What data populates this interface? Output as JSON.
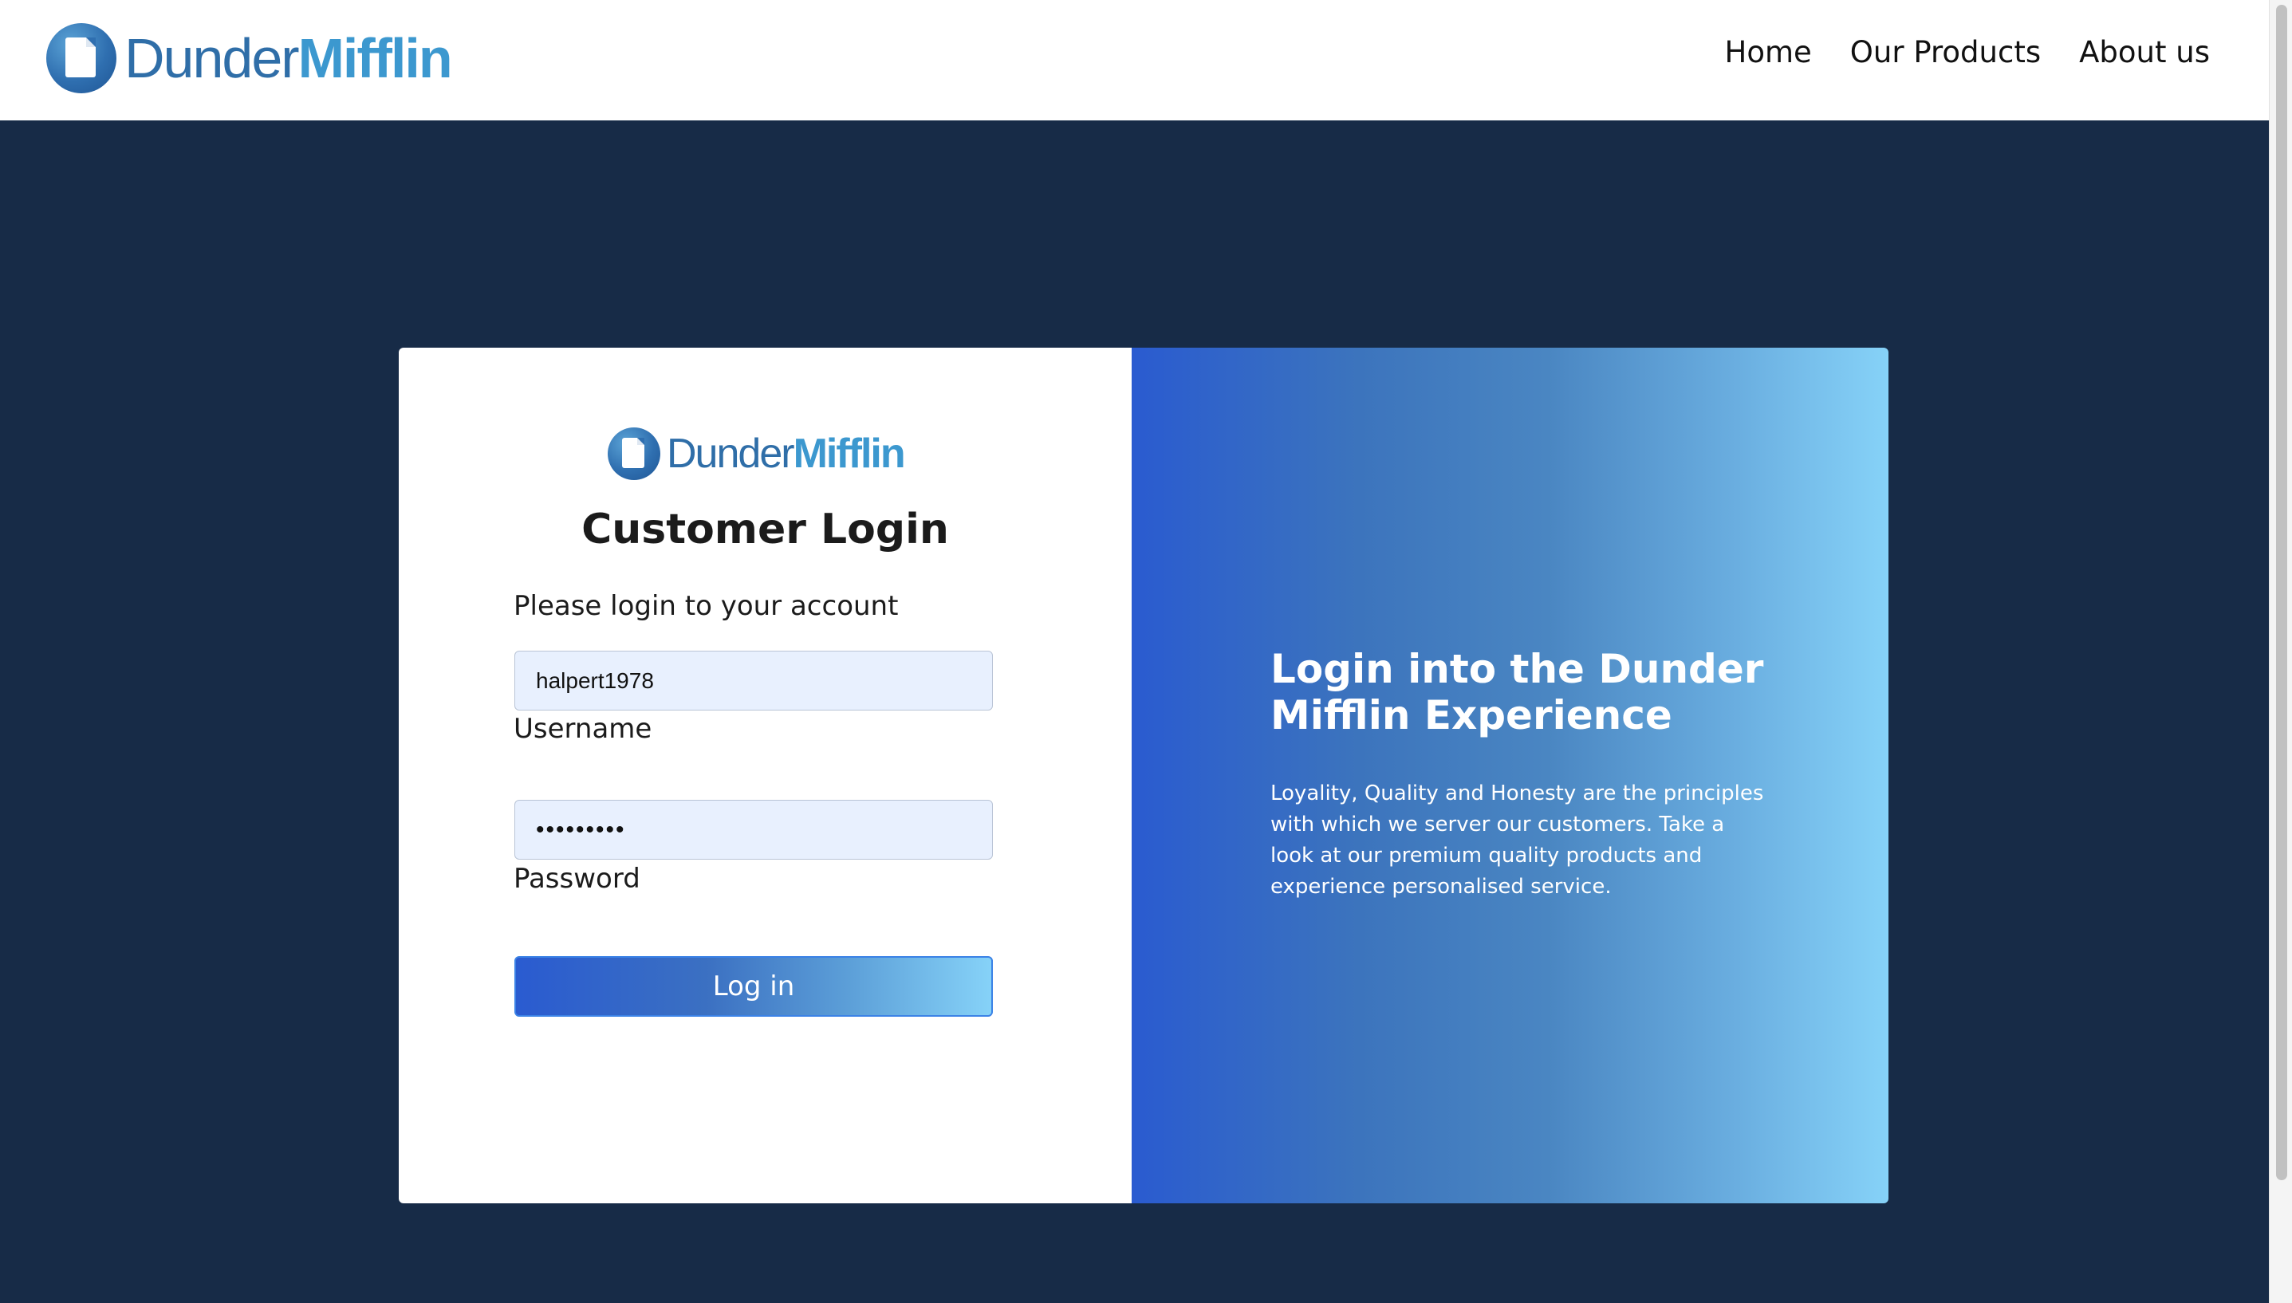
{
  "header": {
    "brand": {
      "part1": "Dunder",
      "part2": "Mifflin"
    },
    "nav": [
      {
        "label": "Home"
      },
      {
        "label": "Our Products"
      },
      {
        "label": "About us"
      }
    ]
  },
  "login": {
    "brand": {
      "part1": "Dunder",
      "part2": "Mifflin"
    },
    "title": "Customer Login",
    "subtitle": "Please login to your account",
    "username": {
      "value": "halpert1978",
      "label": "Username"
    },
    "password": {
      "value": "•••••••••",
      "label": "Password"
    },
    "submit_label": "Log in"
  },
  "promo": {
    "title": "Login into the Dunder Mifflin Experience",
    "body": "Loyality, Quality and Honesty are the principles with which we server our customers. Take a look at our premium quality products and experience personalised service."
  },
  "colors": {
    "header_bg": "#ffffff",
    "page_bg": "#172b47",
    "brand_dark": "#2f6ea8",
    "brand_light": "#3c98cf",
    "gradient_start": "#2a5bd0",
    "gradient_end": "#86d2f8",
    "input_bg": "#e8f0fe"
  }
}
